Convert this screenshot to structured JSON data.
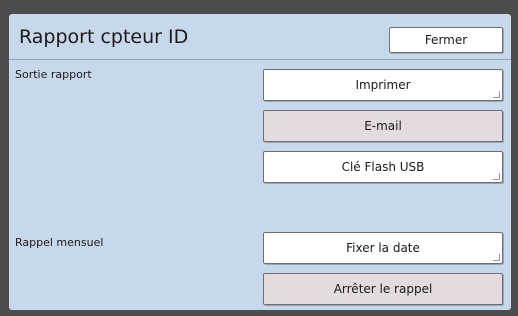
{
  "dialog": {
    "title": "Rapport cpteur ID",
    "close_label": "Fermer"
  },
  "report_output": {
    "label": "Sortie rapport",
    "print_label": "Imprimer",
    "email_label": "E-mail",
    "usb_label": "Clé Flash USB"
  },
  "monthly_reminder": {
    "label": "Rappel mensuel",
    "set_date_label": "Fixer la date",
    "stop_reminder_label": "Arrêter le rappel"
  }
}
